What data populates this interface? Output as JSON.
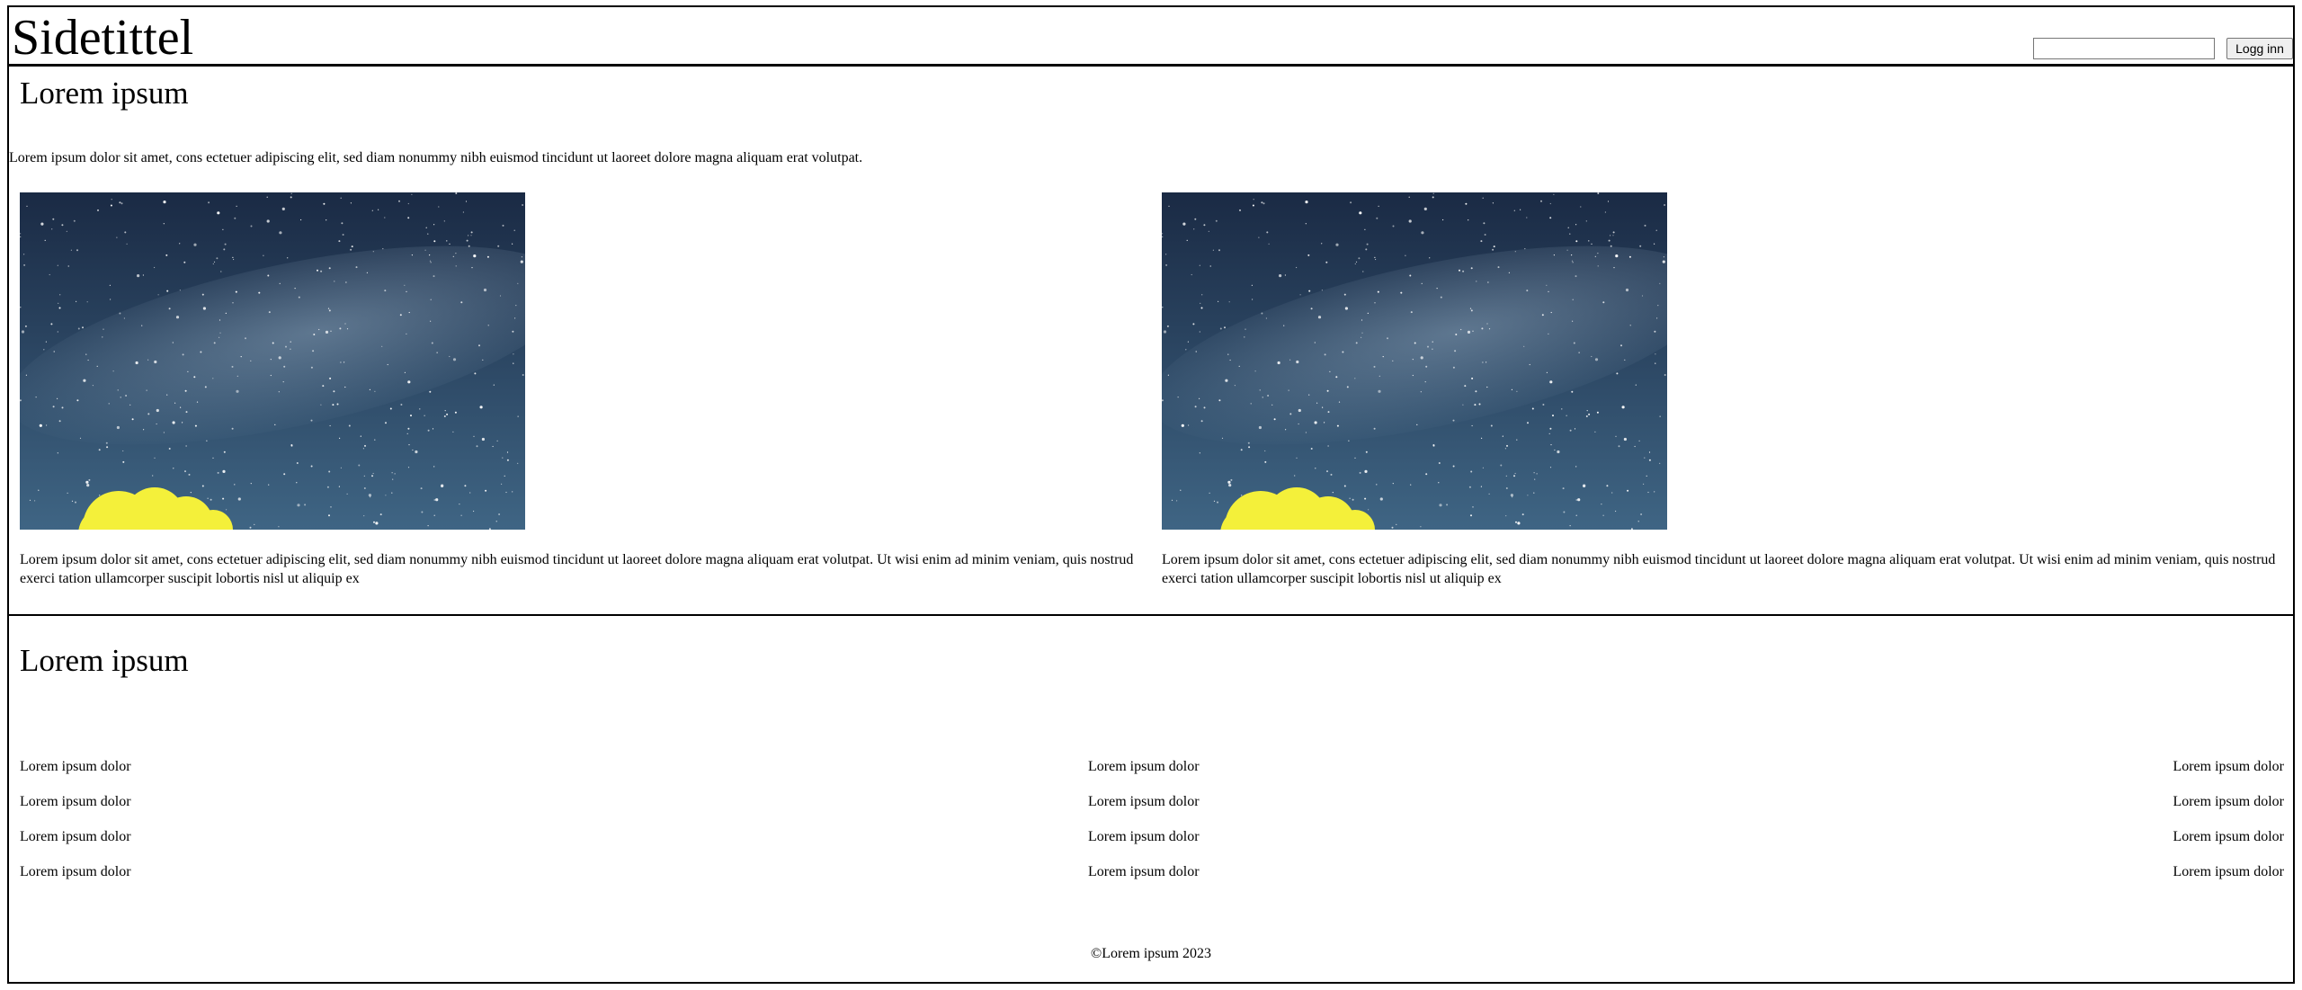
{
  "header": {
    "site_title": "Sidetittel",
    "login_input_value": "",
    "login_button_label": "Logg inn"
  },
  "section1": {
    "heading": "Lorem ipsum",
    "intro": "Lorem ipsum dolor sit amet, cons ectetuer adipiscing elit, sed diam nonummy nibh euismod tincidunt ut laoreet dolore magna aliquam erat volutpat.",
    "cards": [
      {
        "image": "night-sky-milky-way-photo",
        "text": "Lorem ipsum dolor sit amet, cons ectetuer adipiscing elit, sed diam nonummy nibh euismod tincidunt ut laoreet dolore magna aliquam erat volutpat. Ut wisi enim ad minim veniam, quis nostrud exerci tation ullamcorper suscipit lobortis nisl ut aliquip ex"
      },
      {
        "image": "night-sky-milky-way-photo",
        "text": "Lorem ipsum dolor sit amet, cons ectetuer adipiscing elit, sed diam nonummy nibh euismod tincidunt ut laoreet dolore magna aliquam erat volutpat. Ut wisi enim ad minim veniam, quis nostrud exerci tation ullamcorper suscipit lobortis nisl ut aliquip ex"
      }
    ]
  },
  "section2": {
    "heading": "Lorem ipsum",
    "columns": [
      [
        "Lorem ipsum dolor",
        "Lorem ipsum dolor",
        "Lorem ipsum dolor",
        "Lorem ipsum dolor"
      ],
      [
        "Lorem ipsum dolor",
        "Lorem ipsum dolor",
        "Lorem ipsum dolor",
        "Lorem ipsum dolor"
      ],
      [
        "Lorem ipsum dolor",
        "Lorem ipsum dolor",
        "Lorem ipsum dolor",
        "Lorem ipsum dolor"
      ]
    ]
  },
  "footer": {
    "copyright": "©Lorem ipsum 2023"
  },
  "colors": {
    "border": "#000000",
    "sky_dark": "#1a2a44",
    "sky_light": "#3f6584",
    "flare": "#f4f03a"
  }
}
